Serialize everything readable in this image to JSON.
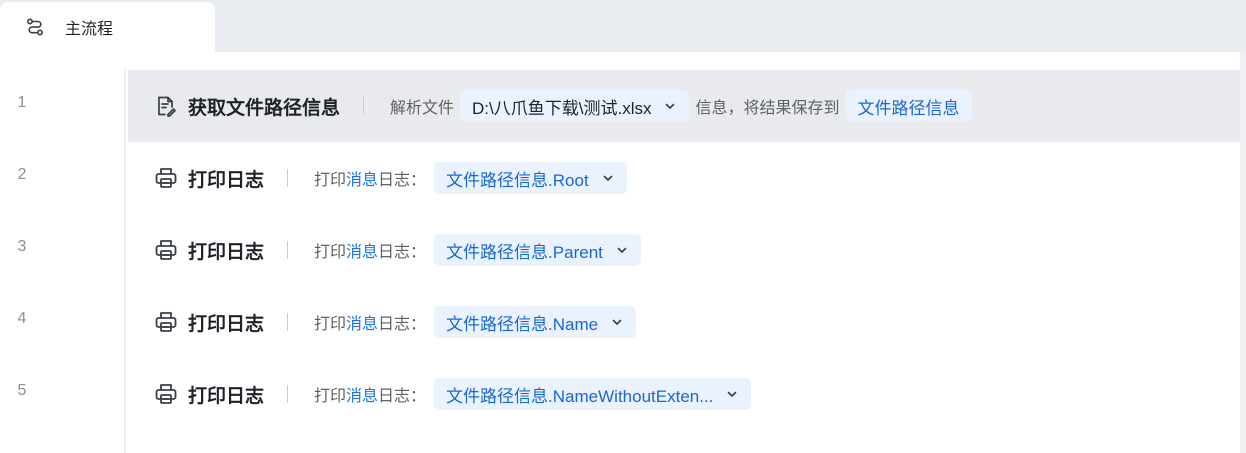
{
  "tabs": [
    {
      "label": "主流程",
      "icon": "flow-icon"
    }
  ],
  "lines": [
    "1",
    "2",
    "3",
    "4",
    "5"
  ],
  "steps": [
    {
      "icon": "document-icon",
      "title": "获取文件路径信息",
      "parts": {
        "prefix": "解析文件",
        "file_value": "D:\\八爪鱼下载\\测试.xlsx",
        "middle": "信息，将结果保存到",
        "result_var": "文件路径信息"
      }
    },
    {
      "icon": "printer-icon",
      "title": "打印日志",
      "label_a": "打印",
      "label_b": "消息",
      "label_c": "日志：",
      "value": "文件路径信息.Root"
    },
    {
      "icon": "printer-icon",
      "title": "打印日志",
      "label_a": "打印",
      "label_b": "消息",
      "label_c": "日志：",
      "value": "文件路径信息.Parent"
    },
    {
      "icon": "printer-icon",
      "title": "打印日志",
      "label_a": "打印",
      "label_b": "消息",
      "label_c": "日志：",
      "value": "文件路径信息.Name"
    },
    {
      "icon": "printer-icon",
      "title": "打印日志",
      "label_a": "打印",
      "label_b": "消息",
      "label_c": "日志：",
      "value": "文件路径信息.NameWithoutExten..."
    }
  ],
  "colors": {
    "accent": "#1a73e8",
    "chip_bg": "#eaf2fd",
    "selected_row_bg": "#e8eaee",
    "tabbar_bg": "#e9ecf1"
  }
}
